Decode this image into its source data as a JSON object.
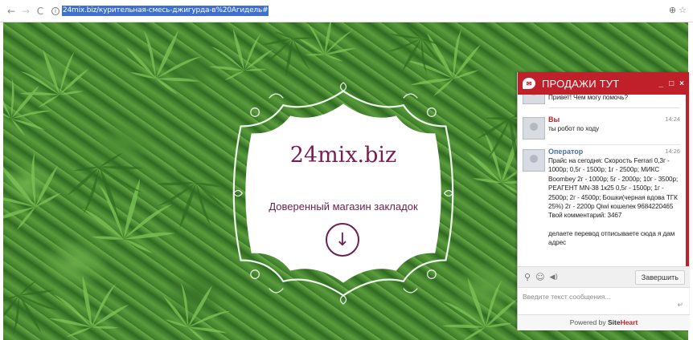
{
  "browser": {
    "back_icon": "←",
    "forward_icon": "→",
    "reload_icon": "C",
    "info_icon": "i",
    "url": "24mix.biz/курительная-смесь-джигурда-в%20Агидель#",
    "zoom_icon": "⊕",
    "star_icon": "☆"
  },
  "site": {
    "title": "24mix.biz",
    "subtitle": "Доверенный магазин закладок",
    "scroll_icon": "↓"
  },
  "chat": {
    "title": "ПРОДАЖИ ТУТ",
    "logo_icon": "✉",
    "minimize": "_",
    "maximize": "□",
    "close": "×",
    "messages": [
      {
        "text": "Привет! Чем могу помочь?"
      },
      {
        "name": "Вы",
        "time": "14:24",
        "text": "ты робот по ходу"
      },
      {
        "name": "Оператор",
        "time": "14:26",
        "text": "Прайс на сегодня: Скорость Ferrari 0,3г - 1000р; 0,5г - 1500р; 1г - 2500р; МИКС Boombey 2г - 1000р; 5г - 2000р; 10г - 3500р; РЕАГЕНТ MN-38 1к25 0,5г - 1500р; 1г - 2500р; 2г - 4500р; Бошки(черная вдова ТГК 25%) 2г - 2200р Qiwi кошелек 9684220465 Твой комментарий: 3467",
        "text2": "делаете перевод отписываете сюда я дам адрес"
      }
    ],
    "attach_icon": "⚲",
    "emoji_icon": "☺",
    "sound_icon": "◀)",
    "finish_label": "Завершить",
    "input_placeholder": "Введите текст сообщения...",
    "enter_icon": "↵",
    "powered_prefix": "Powered by",
    "powered_brand_a": "Site",
    "powered_brand_b": "Heart"
  }
}
